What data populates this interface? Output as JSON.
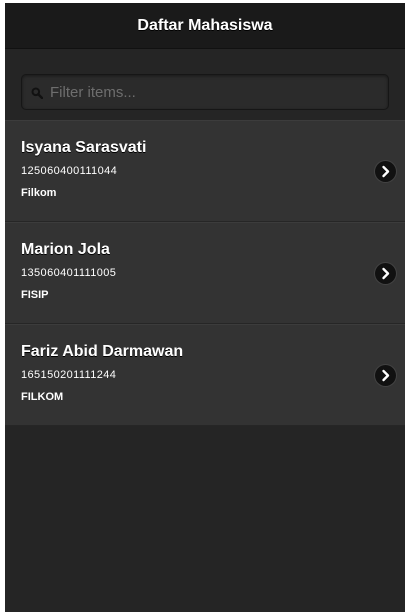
{
  "header": {
    "title": "Daftar Mahasiswa"
  },
  "search": {
    "placeholder": "Filter items...",
    "value": ""
  },
  "students": [
    {
      "name": "Isyana Sarasvati",
      "nim": "125060400111044",
      "faculty": "Filkom"
    },
    {
      "name": "Marion Jola",
      "nim": "135060401111005",
      "faculty": "FISIP"
    },
    {
      "name": "Fariz Abid Darmawan",
      "nim": "165150201111244",
      "faculty": "FILKOM"
    }
  ],
  "icons": {
    "search": "search-icon",
    "row_arrow": "chevron-right-icon"
  },
  "colors": {
    "background": "#252525",
    "header": "#1a1a1a",
    "list_item": "#333333",
    "text": "#ffffff"
  }
}
